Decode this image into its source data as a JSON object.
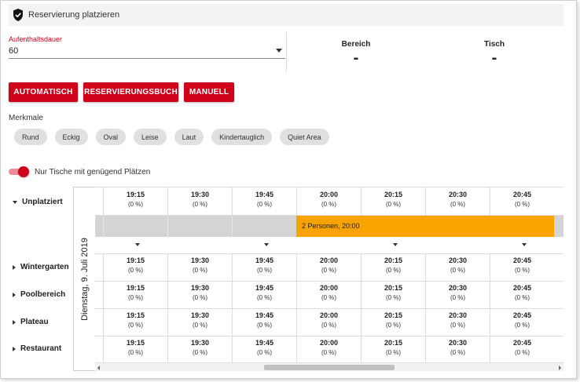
{
  "header": {
    "title": "Reservierung platzieren",
    "icon": "shield-check-icon"
  },
  "duration": {
    "label": "Aufenthaltsdauer",
    "value": "60"
  },
  "info": {
    "bereich_label": "Bereich",
    "bereich_value": "-",
    "tisch_label": "Tisch",
    "tisch_value": "-"
  },
  "buttons": {
    "automatisch": "AUTOMATISCH",
    "reservierungsbuch": "RESERVIERUNGSBUCH",
    "manuell": "MANUELL"
  },
  "merkmale": {
    "label": "Merkmale",
    "chips": [
      "Rund",
      "Eckig",
      "Oval",
      "Leise",
      "Laut",
      "Kindertauglich",
      "Quiet Area"
    ]
  },
  "toggle": {
    "label": "Nur Tische mit genügend Plätzen",
    "on": true
  },
  "date": "Dienstag, 9. Juli 2019",
  "groups": [
    {
      "label": "Unplatziert",
      "expanded": true
    },
    {
      "label": "Wintergarten",
      "expanded": false
    },
    {
      "label": "Poolbereich",
      "expanded": false
    },
    {
      "label": "Plateau",
      "expanded": false
    },
    {
      "label": "Restaurant",
      "expanded": false
    }
  ],
  "times": [
    "19:15",
    "19:30",
    "19:45",
    "20:00",
    "20:15",
    "20:30",
    "20:45"
  ],
  "occupancy": "(0 %)",
  "reservation": {
    "label": "2 Personen, 20:00"
  },
  "colors": {
    "accent": "#d0021b",
    "reservation": "#f9a300",
    "chip": "#e0e0e0"
  }
}
